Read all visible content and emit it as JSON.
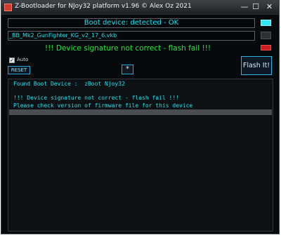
{
  "window": {
    "title": "Z-Bootloader for NJoy32 platform v1.96 © Alex Oz 2021",
    "min_glyph": "—",
    "max_glyph": "☐",
    "close_glyph": "✕"
  },
  "status": {
    "text": "Boot device: detected - OK",
    "led_color": "#32e7f2"
  },
  "file": {
    "value": "_BB_Mk2_GunFighter_KG_v2_17_6.vkb"
  },
  "message": {
    "text": "!!! Device signature not correct - flash fail !!!",
    "color": "#20e83a",
    "led_color": "#cc1c1c"
  },
  "auto": {
    "label": "Auto",
    "checked": true,
    "check_glyph": "✓"
  },
  "buttons": {
    "reset": "RESET",
    "star": "*",
    "flash": "Flash It!"
  },
  "log": {
    "lines": [
      "Found Boot Device :  zBoot Njoy32",
      "!!! Device signature not correct - flash fail !!!",
      "Please check version of firmware file for this device"
    ]
  }
}
